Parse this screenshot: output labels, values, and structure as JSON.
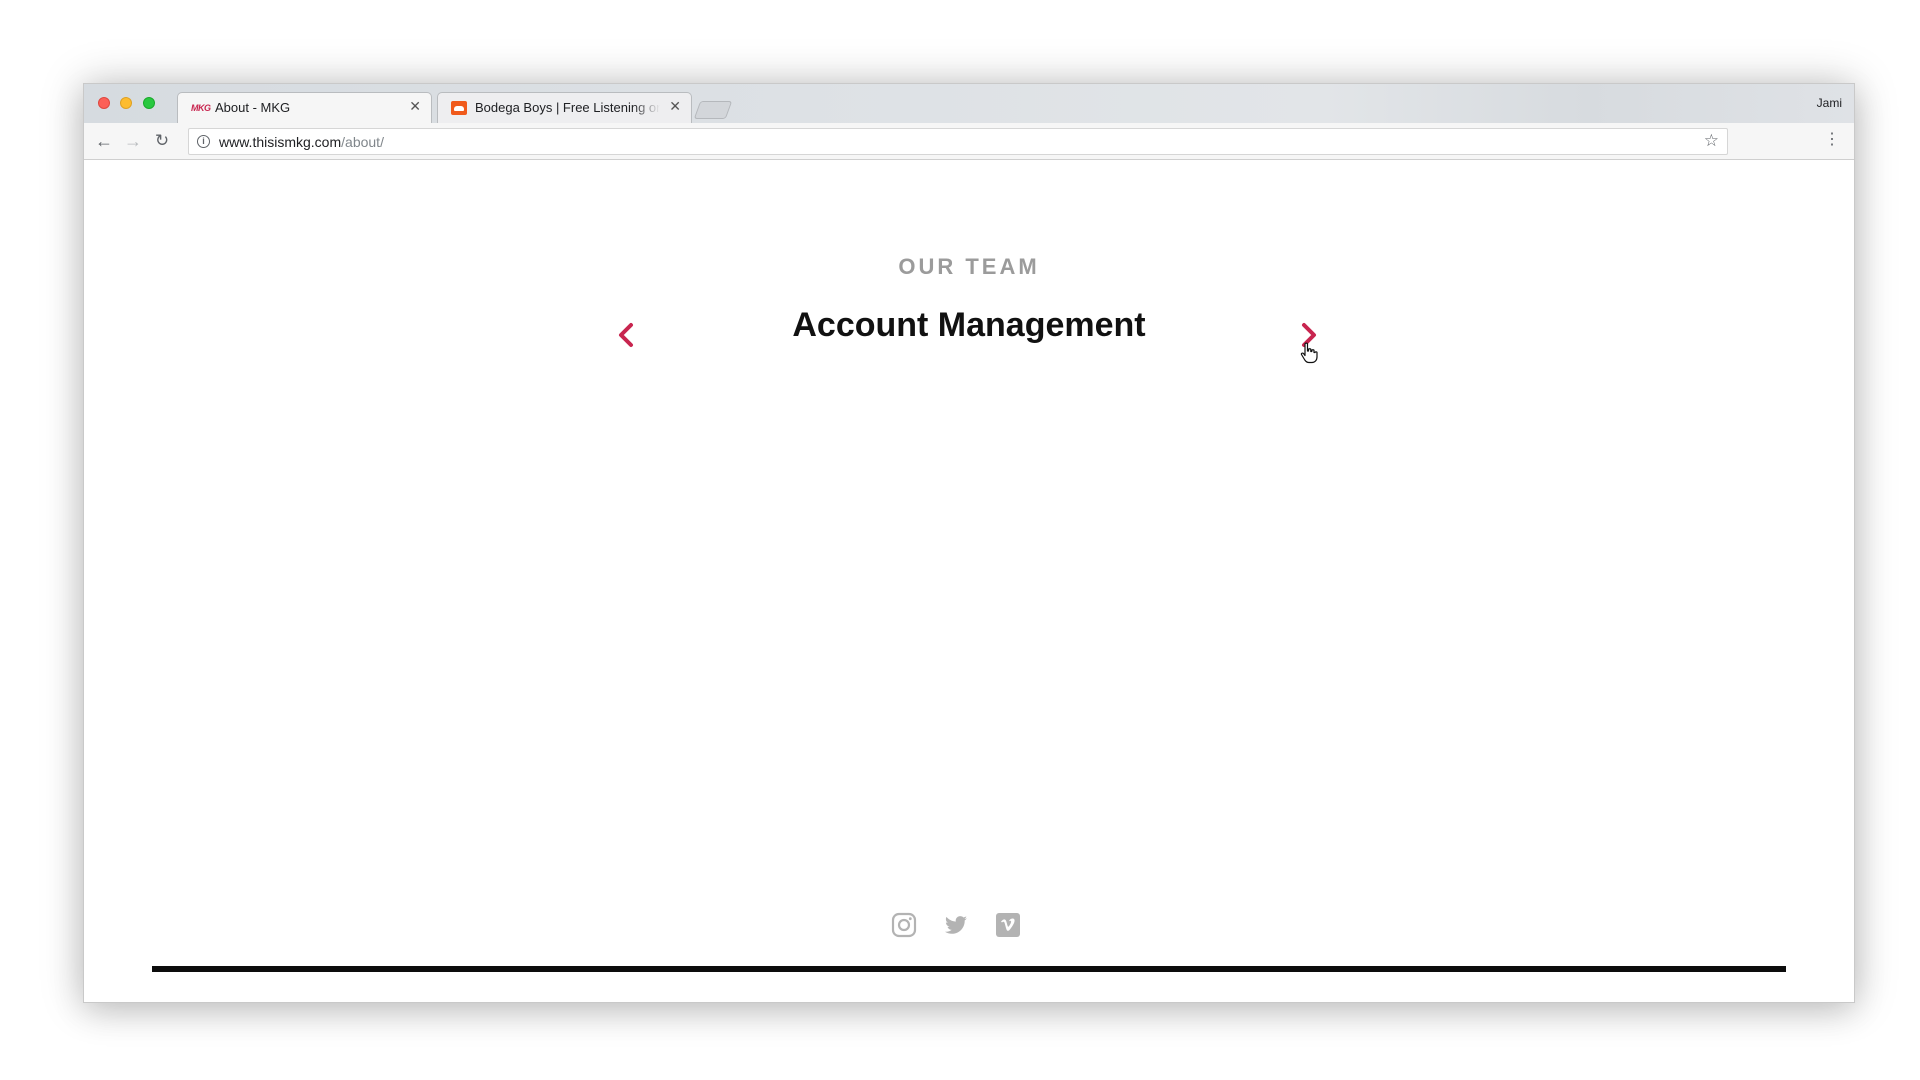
{
  "browser": {
    "tabs": [
      {
        "title": "About - MKG",
        "favicon": "mkg-logo",
        "favicon_text": "MKG",
        "active": true
      },
      {
        "title": "Bodega Boys | Free Listening on SoundCloud",
        "favicon": "soundcloud-logo",
        "active": false
      }
    ],
    "profile_name": "Jami",
    "url_domain": "www.thisismkg.com",
    "url_path": "/about/"
  },
  "page": {
    "section_label": "OUR TEAM",
    "team_title": "Account Management",
    "accent_color": "#c8254f"
  },
  "footer": {
    "social_icons": [
      "instagram-icon",
      "twitter-icon",
      "vimeo-icon"
    ]
  }
}
